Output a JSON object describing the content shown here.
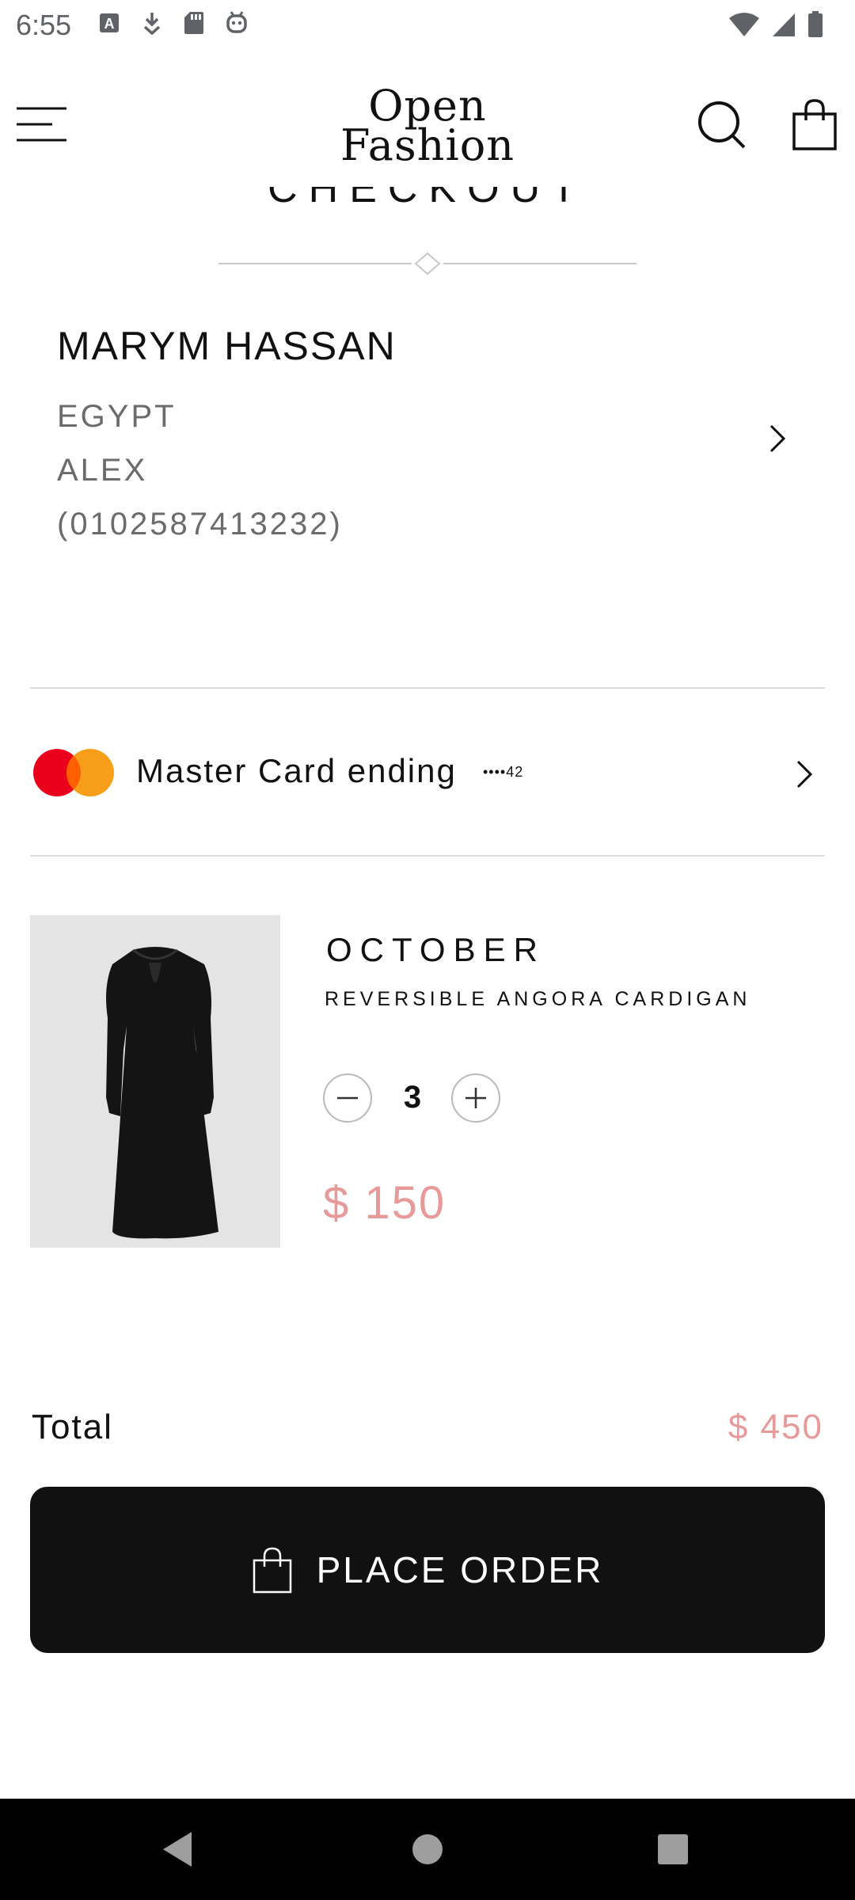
{
  "status_bar": {
    "time": "6:55",
    "left_icons": [
      "a-box-icon",
      "download-icon",
      "sd-card-icon",
      "android-icon"
    ],
    "right_icons": [
      "wifi-icon",
      "signal-icon",
      "battery-icon"
    ]
  },
  "header": {
    "logo_line1": "Open",
    "logo_line2": "Fashion",
    "icons": [
      "menu-icon",
      "search-icon",
      "shopping-bag-icon"
    ]
  },
  "page": {
    "title": "CHECKOUT"
  },
  "address": {
    "name": "MARYM HASSAN",
    "country": "EGYPT",
    "city": "ALEX",
    "phone": "(0102587413232)"
  },
  "payment": {
    "label": "Master Card ending",
    "masked": "••••42",
    "colors": {
      "red": "#eb001b",
      "orange": "#f79e1b"
    }
  },
  "product": {
    "brand": "OCTOBER",
    "name": "REVERSIBLE ANGORA CARDIGAN",
    "quantity": "3",
    "price": "$ 150"
  },
  "summary": {
    "total_label": "Total",
    "total_value": "$ 450"
  },
  "actions": {
    "place_order_label": "PLACE ORDER"
  },
  "colors": {
    "accent": "#e89a9a",
    "button": "#111111"
  }
}
